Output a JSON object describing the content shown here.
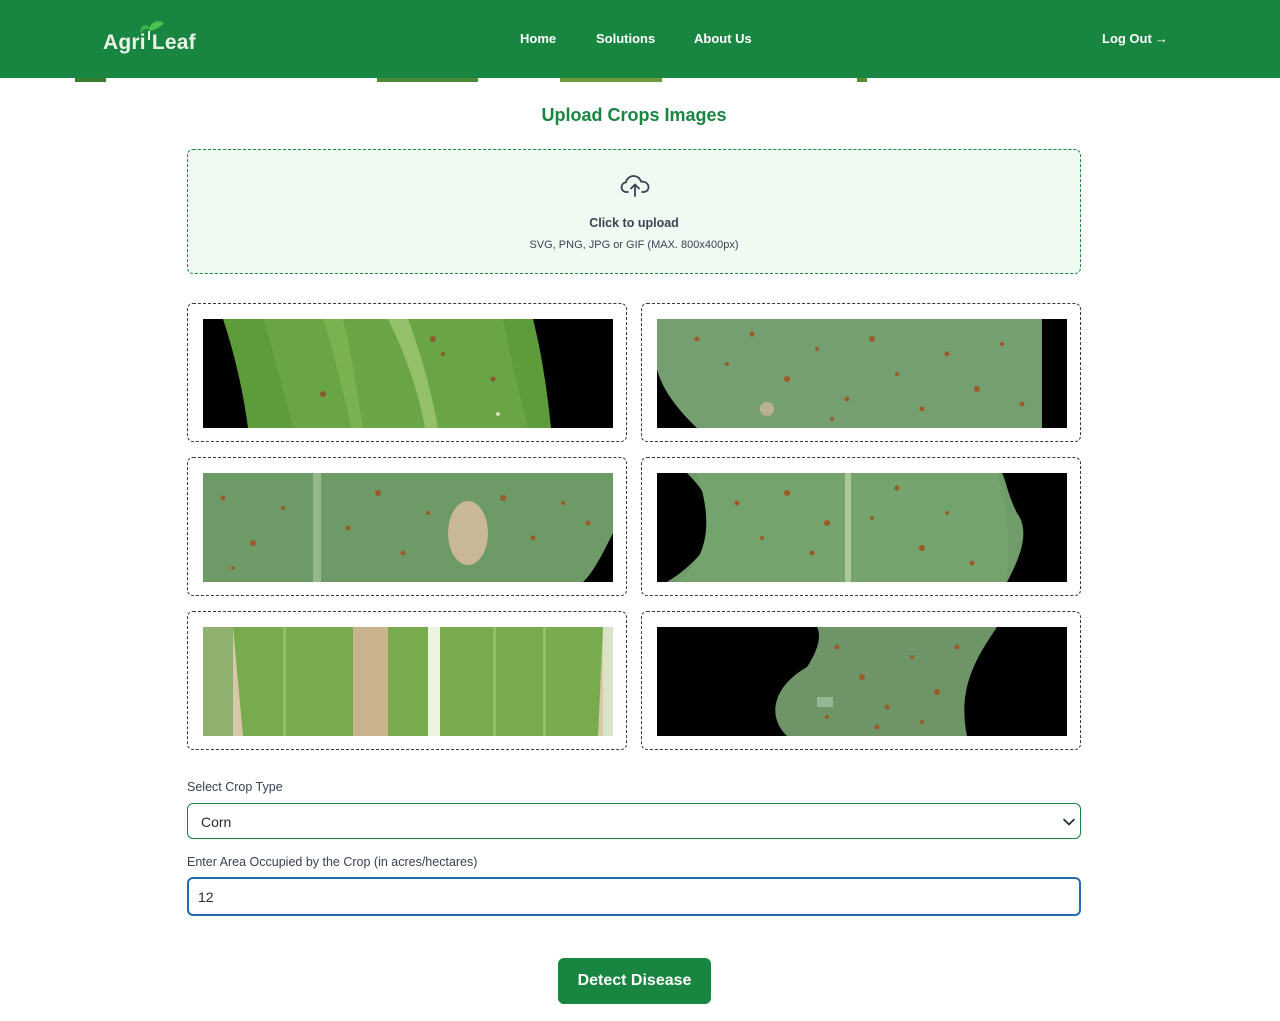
{
  "header": {
    "logo_part1": "Agri",
    "logo_part2": "Leaf",
    "logo_icon": "leaf-icon",
    "nav": {
      "home": "Home",
      "solutions": "Solutions",
      "about": "About Us"
    },
    "logout_label": "Log Out",
    "logout_icon": "→"
  },
  "page_title": "Upload Crops Images",
  "upload": {
    "icon": "cloud-upload-icon",
    "label": "Click to upload",
    "hint": "SVG, PNG, JPG or GIF (MAX. 800x400px)"
  },
  "images": [
    {
      "subject": "corn leaf"
    },
    {
      "subject": "corn leaf"
    },
    {
      "subject": "corn leaf"
    },
    {
      "subject": "corn leaf"
    },
    {
      "subject": "corn leaf"
    },
    {
      "subject": "corn leaf"
    }
  ],
  "form": {
    "crop_type_label": "Select Crop Type",
    "crop_type_value": "Corn",
    "area_label": "Enter Area Occupied by the Crop (in acres/hectares)",
    "area_value": "12"
  },
  "detect_button_label": "Detect Disease",
  "colors": {
    "brand": "#188540",
    "upload_bg": "#effbf2",
    "focus_border": "#1f6cb0"
  }
}
